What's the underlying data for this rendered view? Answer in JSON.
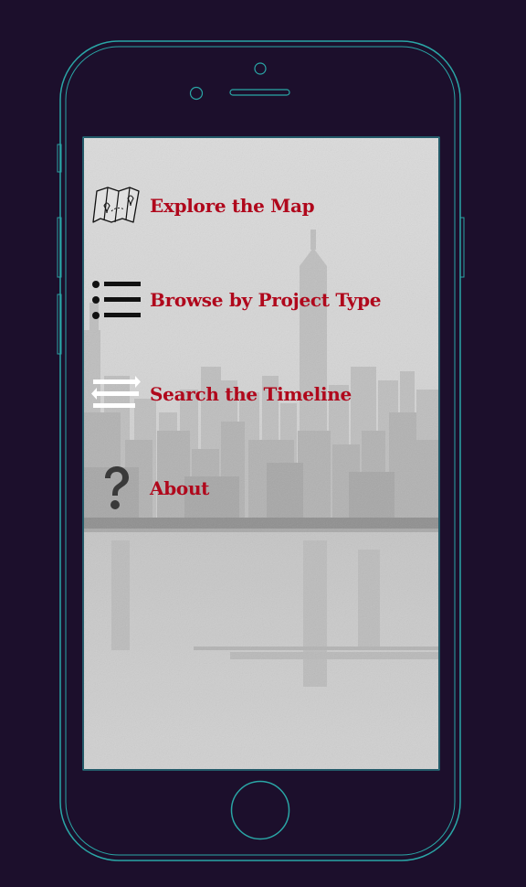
{
  "menu": {
    "items": [
      {
        "label": "Explore the Map",
        "icon": "map-icon"
      },
      {
        "label": "Browse by Project Type",
        "icon": "list-icon"
      },
      {
        "label": "Search the Timeline",
        "icon": "timeline-arrows-icon"
      },
      {
        "label": "About",
        "icon": "question-icon"
      }
    ]
  },
  "colors": {
    "background": "#1c0f2c",
    "phone_outline": "#2aa6a6",
    "menu_label": "#b0081c",
    "icon_dark": "#111111",
    "icon_light": "#ffffff",
    "icon_gray": "#3a3a3a"
  }
}
